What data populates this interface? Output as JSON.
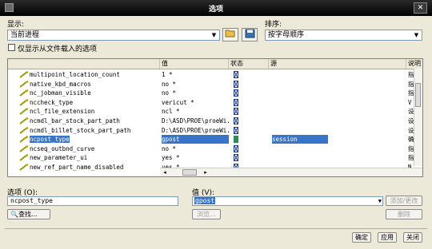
{
  "window": {
    "title": "选项"
  },
  "display": {
    "label": "显示:",
    "value": "当前进程"
  },
  "sort": {
    "label": "排序:",
    "value": "按字母顺序"
  },
  "loaded_only": {
    "label": "仅显示从文件载入的选项",
    "checked": false
  },
  "columns": [
    "",
    "值",
    "状态",
    "源",
    "说明"
  ],
  "rows": [
    {
      "name": "multipoint_location_count",
      "value": "1 *",
      "source": "",
      "desc": "指"
    },
    {
      "name": "native_kbd_macros",
      "value": "no *",
      "source": "",
      "desc": "指"
    },
    {
      "name": "nc_jobman_visible",
      "value": "no *",
      "source": "",
      "desc": "指"
    },
    {
      "name": "nccheck_type",
      "value": "vericut *",
      "source": "",
      "desc": "V"
    },
    {
      "name": "ncl_file_extension",
      "value": "ncl *",
      "source": "",
      "desc": "设"
    },
    {
      "name": "ncmdl_bar_stock_part_path",
      "value": "D:\\ASD\\PROE\\proeWi...",
      "source": "",
      "desc": "设"
    },
    {
      "name": "ncmdl_billet_stock_part_path",
      "value": "D:\\ASD\\PROE\\proeWi...",
      "source": "",
      "desc": "设"
    },
    {
      "name": "ncpost_type",
      "value": "gpost",
      "source": "session",
      "desc": "确",
      "selected": true
    },
    {
      "name": "ncseq_outbnd_curve",
      "value": "no *",
      "source": "",
      "desc": "指"
    },
    {
      "name": "new_parameter_ui",
      "value": "yes *",
      "source": "",
      "desc": "指"
    },
    {
      "name": "new_ref_part_name_disabled",
      "value": "yes *",
      "source": "",
      "desc": "N"
    }
  ],
  "option": {
    "label": "选项 (O):",
    "value": "ncpost_type"
  },
  "value": {
    "label": "值 (V):",
    "value": "gpost"
  },
  "buttons": {
    "find": "查找...",
    "browse": "浏览...",
    "add_change": "添加/更改",
    "delete": "删除",
    "ok": "确定",
    "apply": "应用",
    "close": "关闭"
  },
  "colors": {
    "selection": "#3875c8",
    "status_icon": "#1f3d99",
    "status_selected": "#2e8b57"
  },
  "icons": {
    "window": "app-icon",
    "close": "close-icon",
    "open": "folder-open-icon",
    "save": "save-icon",
    "pin": "option-pin-icon",
    "find": "find-icon"
  }
}
